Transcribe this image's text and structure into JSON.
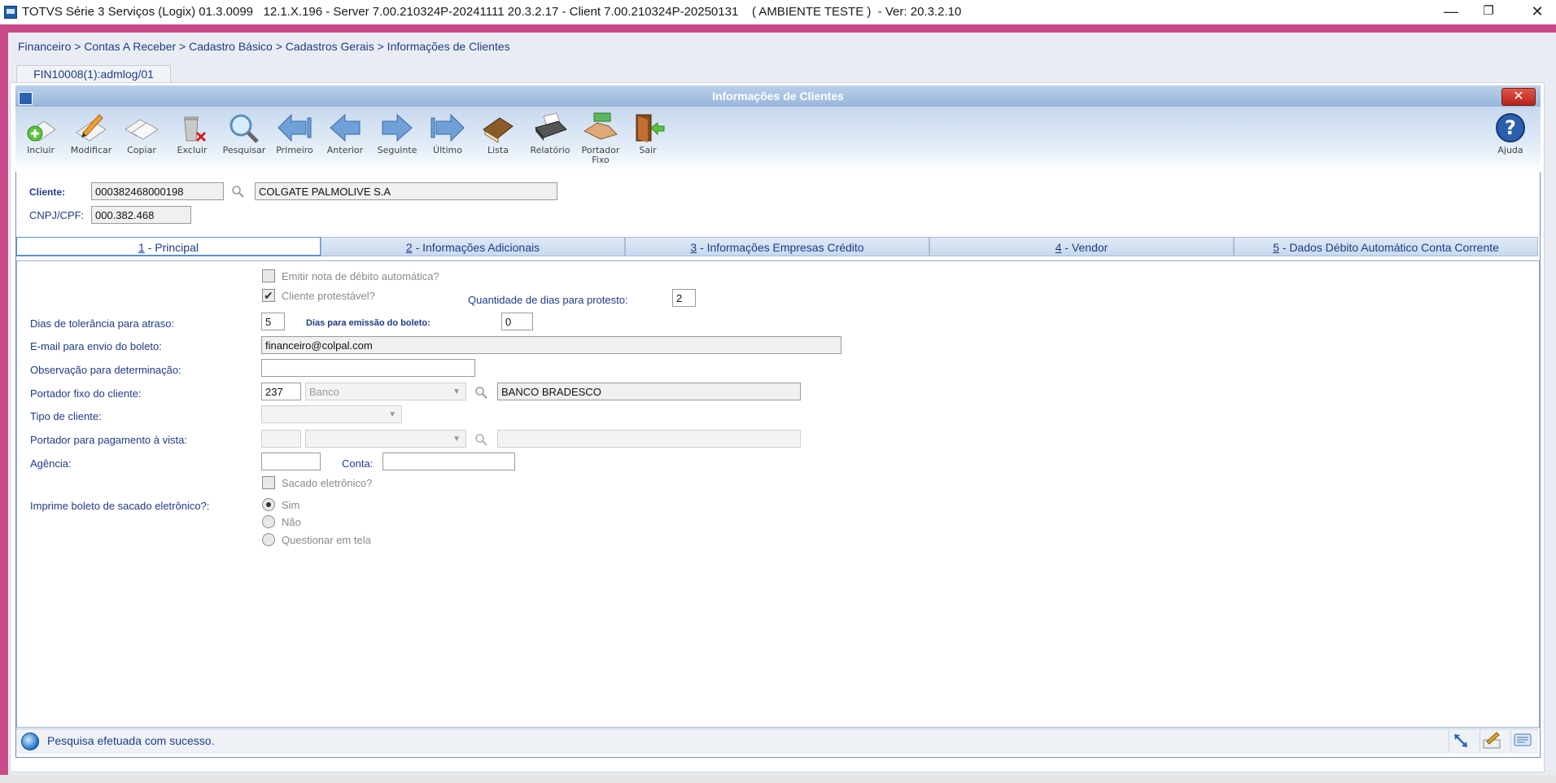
{
  "window": {
    "title": "TOTVS Série 3 Serviços (Logix) 01.3.0099   12.1.X.196 - Server 7.00.210324P-20241111 20.3.2.17 - Client 7.00.210324P-20250131    ( AMBIENTE TESTE )  - Ver: 20.3.2.10",
    "minimize": "—",
    "restore": "❐",
    "close": "✕"
  },
  "breadcrumb": "Financeiro > Contas A Receber > Cadastro Básico > Cadastros Gerais > Informações de Clientes",
  "session_tab": "FIN10008(1):admlog/01",
  "dialog": {
    "title": "Informações de Clientes",
    "close": "✕"
  },
  "toolbar": {
    "incluir": "Incluir",
    "modificar": "Modificar",
    "copiar": "Copiar",
    "excluir": "Excluir",
    "pesquisar": "Pesquisar",
    "primeiro": "Primeiro",
    "anterior": "Anterior",
    "seguinte": "Seguinte",
    "ultimo": "Último",
    "lista": "Lista",
    "relatorio": "Relatório",
    "portador_fixo_1": "Portador",
    "portador_fixo_2": "Fixo",
    "sair": "Sair",
    "ajuda": "Ajuda"
  },
  "header": {
    "cliente_label": "Cliente:",
    "cliente_code": "000382468000198",
    "cliente_name": "COLGATE PALMOLIVE S.A",
    "cnpj_label": "CNPJ/CPF:",
    "cnpj_value": "000.382.468"
  },
  "tabs": [
    {
      "num": "1",
      "label": " - Principal"
    },
    {
      "num": "2",
      "label": " - Informações Adicionais"
    },
    {
      "num": "3",
      "label": " - Informações Empresas Crédito"
    },
    {
      "num": "4",
      "label": " - Vendor"
    },
    {
      "num": "5",
      "label": " - Dados Débito Automático Conta Corrente"
    }
  ],
  "form": {
    "emitir_nota_label": "Emitir nota de débito automática?",
    "emitir_nota_checked": false,
    "cliente_protestavel_label": "Cliente protestável?",
    "cliente_protestavel_check": "✔",
    "qtd_dias_protesto_label": "Quantidade de dias para protesto:",
    "qtd_dias_protesto_value": "2",
    "dias_tolerancia_label": "Dias de tolerância para atraso:",
    "dias_tolerancia_value": "5",
    "dias_emissao_label": "Dias para emissão do boleto:",
    "dias_emissao_value": "0",
    "email_label": "E-mail para envio do boleto:",
    "email_value": "financeiro@colpal.com",
    "observacao_label": "Observação para determinação:",
    "observacao_value": "",
    "portador_fixo_label": "Portador fixo do cliente:",
    "portador_fixo_code": "237",
    "portador_fixo_tipo": "Banco",
    "portador_fixo_nome": "BANCO BRADESCO",
    "tipo_cliente_label": "Tipo de cliente:",
    "tipo_cliente_value": "",
    "portador_vista_label": "Portador para pagamento à vista:",
    "portador_vista_code": "",
    "portador_vista_tipo": "",
    "portador_vista_nome": "",
    "agencia_label": "Agência:",
    "agencia_value": "",
    "conta_label": "Conta:",
    "conta_value": "",
    "sacado_label": "Sacado eletrônico?",
    "imprime_boleto_label": "Imprime boleto de sacado eletrônico?:",
    "radio_sim": "Sim",
    "radio_nao": "Não",
    "radio_questionar": "Questionar em tela",
    "radio_selected": "Sim"
  },
  "status": {
    "message": "Pesquisa efetuada com sucesso."
  },
  "colors": {
    "accent_pink": "#c94a8a",
    "label_blue": "#1f3b88",
    "dialog_title_bg": "#97b5db"
  }
}
